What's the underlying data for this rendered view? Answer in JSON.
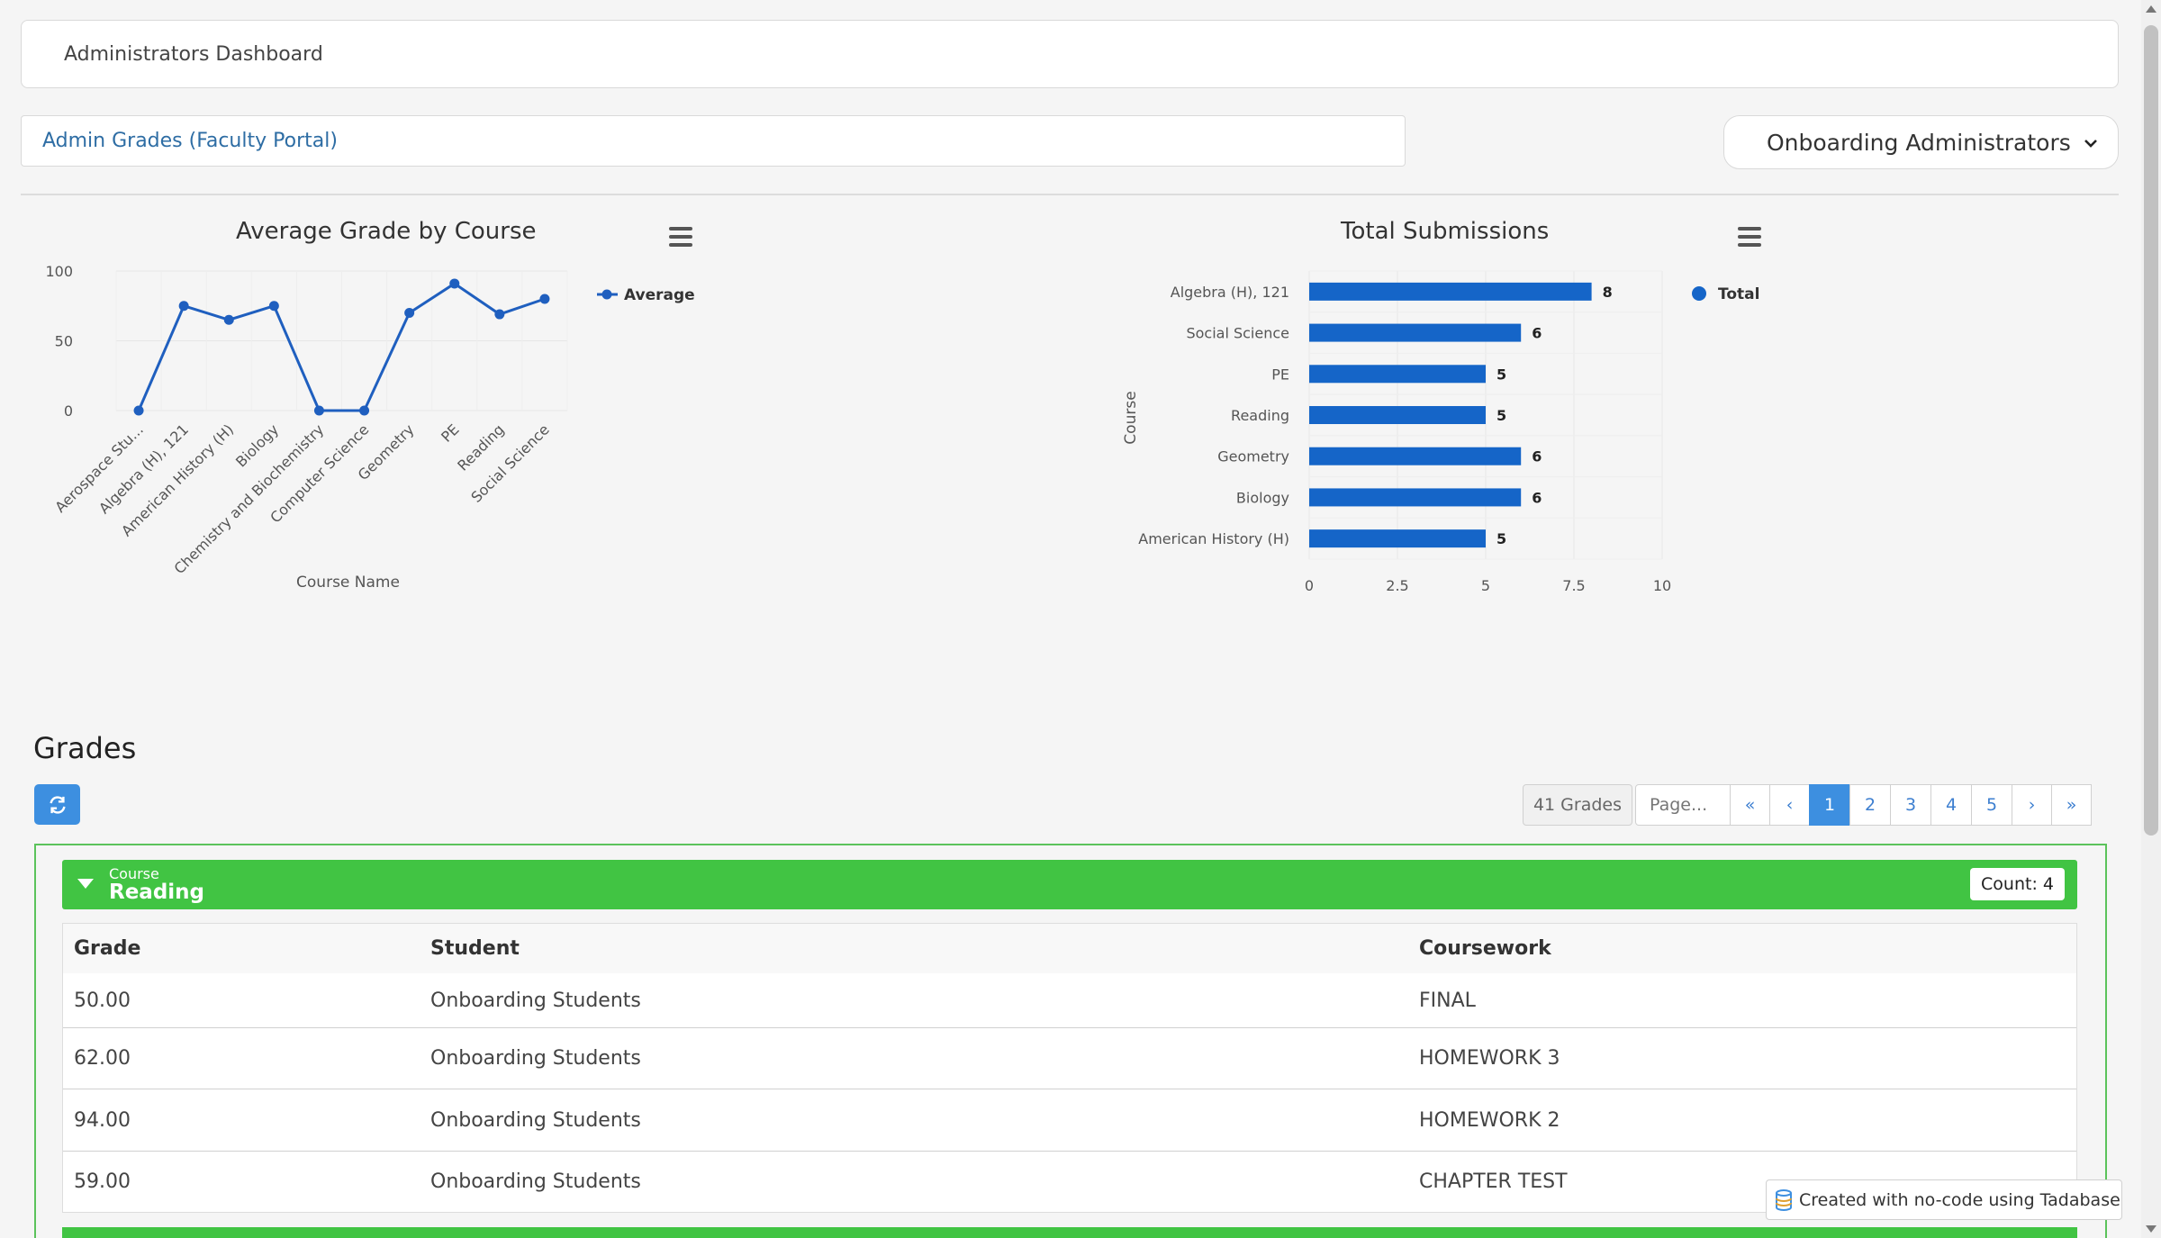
{
  "header": {
    "title": "Administrators Dashboard"
  },
  "breadcrumb": {
    "label": "Admin Grades (Faculty Portal)"
  },
  "user_menu": {
    "label": "Onboarding Administrators"
  },
  "line_chart": {
    "menu_icon": "hamburger-menu-icon"
  },
  "bar_chart": {
    "menu_icon": "hamburger-menu-icon"
  },
  "chart_data": [
    {
      "type": "line",
      "title": "Average Grade by Course",
      "xlabel": "Course Name",
      "ylabel": "",
      "categories": [
        "Aerospace Stu...",
        "Algebra (H), 121",
        "American History (H)",
        "Biology",
        "Chemistry and Biochemistry",
        "Computer Science",
        "Geometry",
        "PE",
        "Reading",
        "Social Science"
      ],
      "series": [
        {
          "name": "Average",
          "values": [
            0,
            75,
            65,
            75,
            0,
            0,
            70,
            91,
            69,
            80
          ]
        }
      ],
      "yticks": [
        "0",
        "50",
        "100"
      ],
      "ylim": [
        0,
        100
      ],
      "grid": true,
      "legend": "right",
      "color": "#1f5fbf"
    },
    {
      "type": "bar",
      "orientation": "horizontal",
      "title": "Total Submissions",
      "xlabel": "",
      "ylabel": "Course",
      "categories": [
        "Algebra (H), 121",
        "Social Science",
        "PE",
        "Reading",
        "Geometry",
        "Biology",
        "American History (H)"
      ],
      "series": [
        {
          "name": "Total",
          "values": [
            8,
            6,
            5,
            5,
            6,
            6,
            5
          ]
        }
      ],
      "xticks": [
        "0",
        "2.5",
        "5",
        "7.5",
        "10"
      ],
      "xlim": [
        0,
        10
      ],
      "grid": true,
      "legend": "right",
      "color": "#1565c8"
    }
  ],
  "grades": {
    "title": "Grades",
    "refresh_icon": "refresh-icon",
    "count_label": "41 Grades",
    "page_placeholder": "Page...",
    "pager": [
      "«",
      "‹",
      "1",
      "2",
      "3",
      "4",
      "5",
      "›",
      "»"
    ],
    "active_page": "1",
    "group": {
      "field_label": "Course",
      "value": "Reading",
      "count": "Count: 4"
    },
    "columns": [
      "Grade",
      "Student",
      "Coursework"
    ],
    "rows": [
      [
        "50.00",
        "Onboarding Students",
        "FINAL"
      ],
      [
        "62.00",
        "Onboarding Students",
        "HOMEWORK 3"
      ],
      [
        "94.00",
        "Onboarding Students",
        "HOMEWORK 2"
      ],
      [
        "59.00",
        "Onboarding Students",
        "CHAPTER TEST"
      ]
    ]
  },
  "footer": {
    "badge": "Created with no-code using Tadabase",
    "icon": "database-icon"
  }
}
